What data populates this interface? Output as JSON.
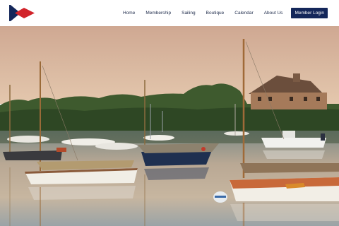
{
  "site": {
    "logo_icon": "burgee-flag-icon",
    "colors": {
      "navy": "#14275a",
      "red": "#d1232a",
      "nav_text": "#1d2a4a"
    }
  },
  "nav": {
    "items": [
      {
        "label": "Home"
      },
      {
        "label": "Membership"
      },
      {
        "label": "Sailing"
      },
      {
        "label": "Boutique"
      },
      {
        "label": "Calendar"
      },
      {
        "label": "About Us"
      }
    ],
    "login_label": "Member Login"
  },
  "hero": {
    "scene": "harbor-sunset-sailboats"
  }
}
